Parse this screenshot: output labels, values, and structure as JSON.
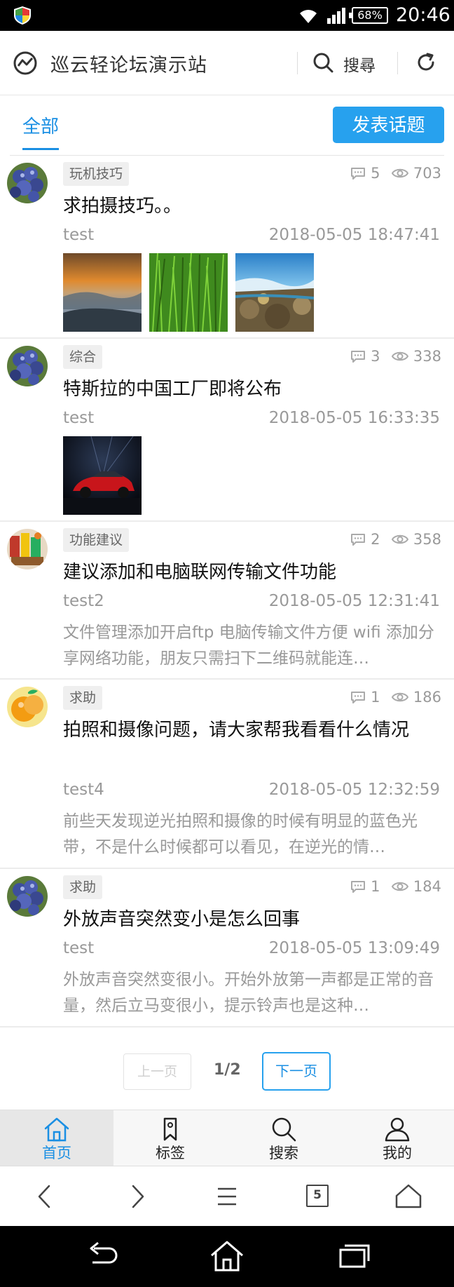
{
  "status_bar": {
    "battery": "68%",
    "time": "20:46"
  },
  "header": {
    "title": "巡云轻论坛演示站",
    "search_label": "搜尋"
  },
  "tabs": {
    "active": "全部",
    "post_button": "发表话题"
  },
  "posts": [
    {
      "tag": "玩机技巧",
      "comments": "5",
      "views": "703",
      "title": "求拍摄技巧。。",
      "author": "test",
      "date": "2018-05-05 18:47:41",
      "excerpt": "",
      "images": [
        "sunset-fog",
        "grass",
        "rocky-coast"
      ]
    },
    {
      "tag": "综合",
      "comments": "3",
      "views": "338",
      "title": "特斯拉的中国工厂即将公布",
      "author": "test",
      "date": "2018-05-05 16:33:35",
      "excerpt": "",
      "images": [
        "red-car"
      ]
    },
    {
      "tag": "功能建议",
      "comments": "2",
      "views": "358",
      "title": "建议添加和电脑联网传输文件功能",
      "author": "test2",
      "date": "2018-05-05 12:31:41",
      "excerpt": "文件管理添加开启ftp 电脑传输文件方便 wifi 添加分享网络功能，朋友只需扫下二维码就能连…",
      "images": []
    },
    {
      "tag": "求助",
      "comments": "1",
      "views": "186",
      "title": "拍照和摄像问题，请大家帮我看看什么情况",
      "author": "test4",
      "date": "2018-05-05 12:32:59",
      "excerpt": "前些天发现逆光拍照和摄像的时候有明显的蓝色光带，不是什么时候都可以看见，在逆光的情…",
      "images": []
    },
    {
      "tag": "求助",
      "comments": "1",
      "views": "184",
      "title": "外放声音突然变小是怎么回事",
      "author": "test",
      "date": "2018-05-05 13:09:49",
      "excerpt": "外放声音突然变很小。开始外放第一声都是正常的音量，然后立马变很小，提示铃声也是这种…",
      "images": []
    }
  ],
  "pager": {
    "prev": "上一页",
    "page": "1/2",
    "next": "下一页"
  },
  "tabbar": {
    "home": "首页",
    "tags": "标签",
    "search": "搜索",
    "mine": "我的"
  },
  "browser": {
    "tab_count": "5"
  },
  "colors": {
    "accent": "#27a1ee",
    "text_muted": "#999999"
  }
}
